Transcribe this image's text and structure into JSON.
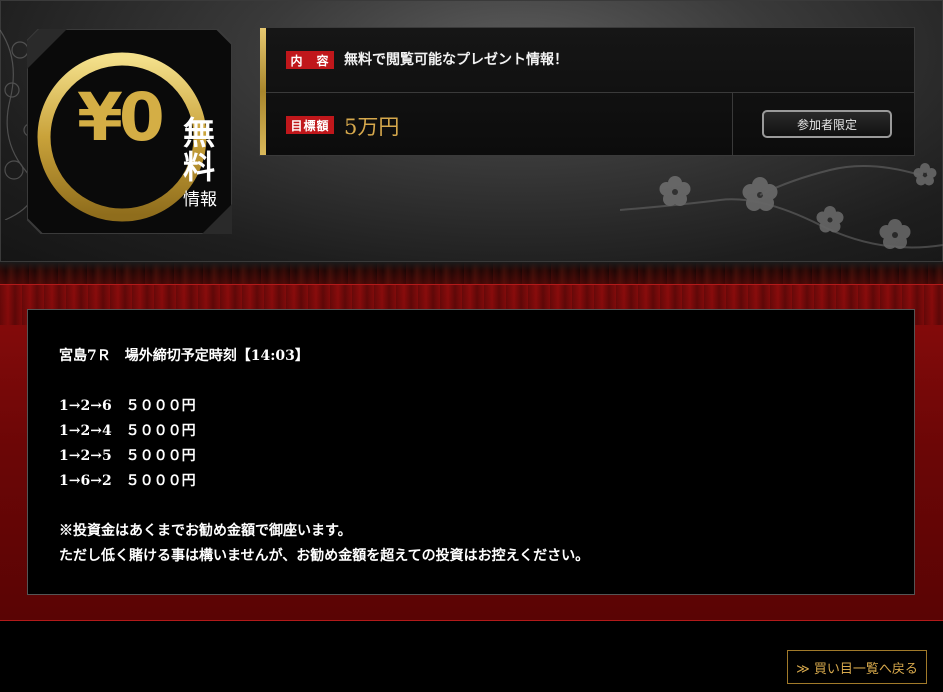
{
  "badge": {
    "yen_text": "¥0",
    "free_text_1": "無",
    "free_text_2": "料",
    "info_text": "情報"
  },
  "info_panel": {
    "content_tag": "内　容",
    "content_text": "無料で閲覧可能なプレゼント情報！",
    "target_tag": "目標額",
    "target_amount": "5万円",
    "participant_button": "参加者限定"
  },
  "message": {
    "lines": [
      "宮島7Ｒ　場外締切予定時刻【14:03】",
      "",
      "1→2→6　５０００円",
      "1→2→4　５０００円",
      "1→2→5　５０００円",
      "1→6→2　５０００円",
      "",
      "※投資金はあくまでお勧め金額で御座います。",
      "ただし低く賭ける事は構いませんが、お勧め金額を超えての投資はお控えください。"
    ]
  },
  "back_button": "≫ 買い目一覧へ戻る",
  "colors": {
    "gold": "#d6a84c",
    "red_tag": "#c0171b",
    "frame_red": "#7a0808"
  }
}
